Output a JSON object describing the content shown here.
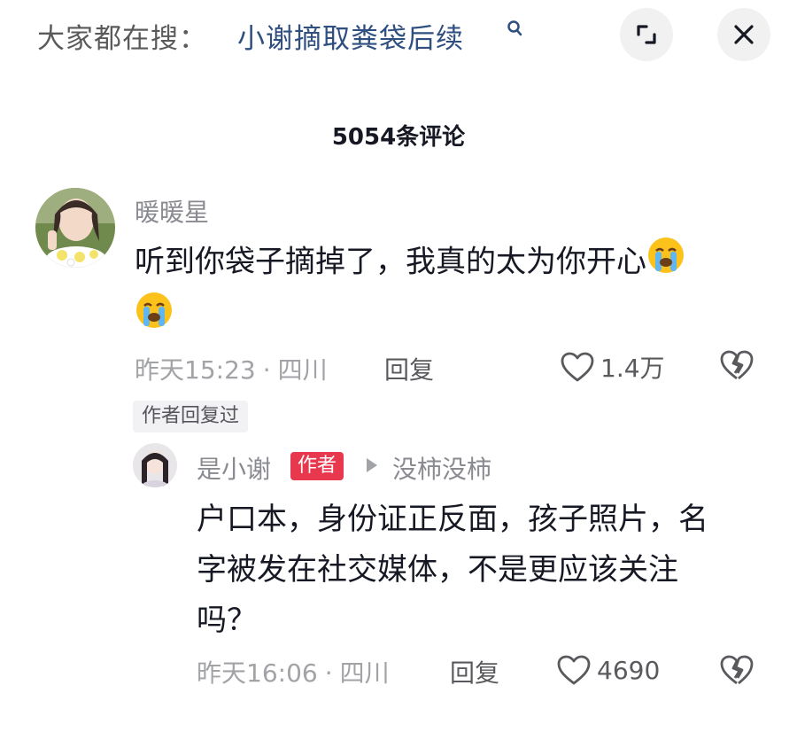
{
  "search_bar": {
    "prefix": "大家都在搜：",
    "term": "小谢摘取粪袋后续",
    "search_icon": "search-icon",
    "expand_icon": "expand-icon",
    "close_icon": "close-icon"
  },
  "comments_header": {
    "count_label": "5054条评论"
  },
  "comments": [
    {
      "username": "暖暖星",
      "avatar_icon": "avatar-photo",
      "lines": [
        "听到你袋子摘掉了，我真的太为你开心",
        ""
      ],
      "emoji": "loudly-crying-face-emoji",
      "time": "昨天15:23",
      "dot": "·",
      "location": "四川",
      "reply_label": "回复",
      "likes": "1.4万",
      "author_replied_tag": "作者回复过"
    }
  ],
  "reply": {
    "username": "是小谢",
    "author_badge": "作者",
    "reply_to": "没柿没柿",
    "lines": [
      "户口本，身份证正反面，孩子照片，名",
      "字被发在社交媒体，不是更应该关注",
      "吗？"
    ],
    "time": "昨天16:06",
    "dot": "·",
    "location": "四川",
    "reply_label": "回复",
    "likes": "4690"
  },
  "colors": {
    "search_term": "#2e4f7f",
    "author_badge_bg": "#e8384d",
    "meta_gray": "#a2a3a7",
    "username_gray": "#8a8b91"
  }
}
